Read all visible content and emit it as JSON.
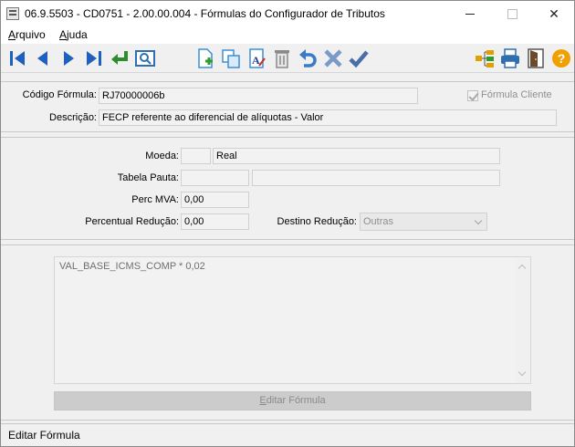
{
  "window": {
    "title": "06.9.5503 - CD0751 - 2.00.00.004 - Fórmulas do Configurador de Tributos",
    "minimize_glyph": "",
    "maximize_glyph": "",
    "close_glyph": "✕"
  },
  "menu": {
    "arquivo": {
      "underline": "A",
      "rest": "rquivo"
    },
    "ajuda": {
      "underline": "A",
      "rest": "juda"
    }
  },
  "toolbar": {
    "buttons": [
      {
        "name": "first-record-icon",
        "color": "#1f5fbf"
      },
      {
        "name": "previous-record-icon",
        "color": "#1f5fbf"
      },
      {
        "name": "next-record-icon",
        "color": "#1f5fbf"
      },
      {
        "name": "last-record-icon",
        "color": "#1f5fbf"
      },
      {
        "name": "return-icon",
        "color": "#2e8b2e"
      },
      {
        "name": "search-icon",
        "color": "#2f6fb0"
      },
      {
        "name": "new-record-icon",
        "color": "#3a8fd8"
      },
      {
        "name": "copy-icon",
        "color": "#3a8fd8"
      },
      {
        "name": "edit-text-icon",
        "color": "#3a8fd8"
      },
      {
        "name": "delete-icon",
        "color": "#8a8a8a"
      },
      {
        "name": "undo-icon",
        "color": "#3a7ac8"
      },
      {
        "name": "cancel-icon",
        "color": "#6f8fb8"
      },
      {
        "name": "confirm-icon",
        "color": "#4a6fa8"
      },
      {
        "name": "tree-structure-icon",
        "color": "#e0a000"
      },
      {
        "name": "print-icon",
        "color": "#2f6fb0"
      },
      {
        "name": "exit-door-icon",
        "color": "#6a4a2a"
      },
      {
        "name": "help-icon",
        "color": "#f0a000"
      }
    ]
  },
  "header_panel": {
    "codigo_label": "Código Fórmula:",
    "codigo_value": "RJ70000006b",
    "formula_cliente_label": "Fórmula Cliente",
    "formula_cliente_checked": true,
    "descricao_label": "Descrição:",
    "descricao_value": "FECP referente ao diferencial de alíquotas - Valor"
  },
  "params_panel": {
    "moeda_label": "Moeda:",
    "moeda_code": "",
    "moeda_value": "Real",
    "tabela_pauta_label": "Tabela Pauta:",
    "tabela_pauta_code": "",
    "tabela_pauta_value": "",
    "perc_mva_label": "Perc MVA:",
    "perc_mva_value": "0,00",
    "percentual_reducao_label": "Percentual Redução:",
    "percentual_reducao_value": "0,00",
    "destino_reducao_label": "Destino Redução:",
    "destino_reducao_value": "Outras"
  },
  "formula_panel": {
    "formula_text": "VAL_BASE_ICMS_COMP * 0,02",
    "edit_button": {
      "underline": "E",
      "rest": "ditar Fórmula"
    }
  },
  "status_bar": {
    "text": "Editar Fórmula"
  }
}
